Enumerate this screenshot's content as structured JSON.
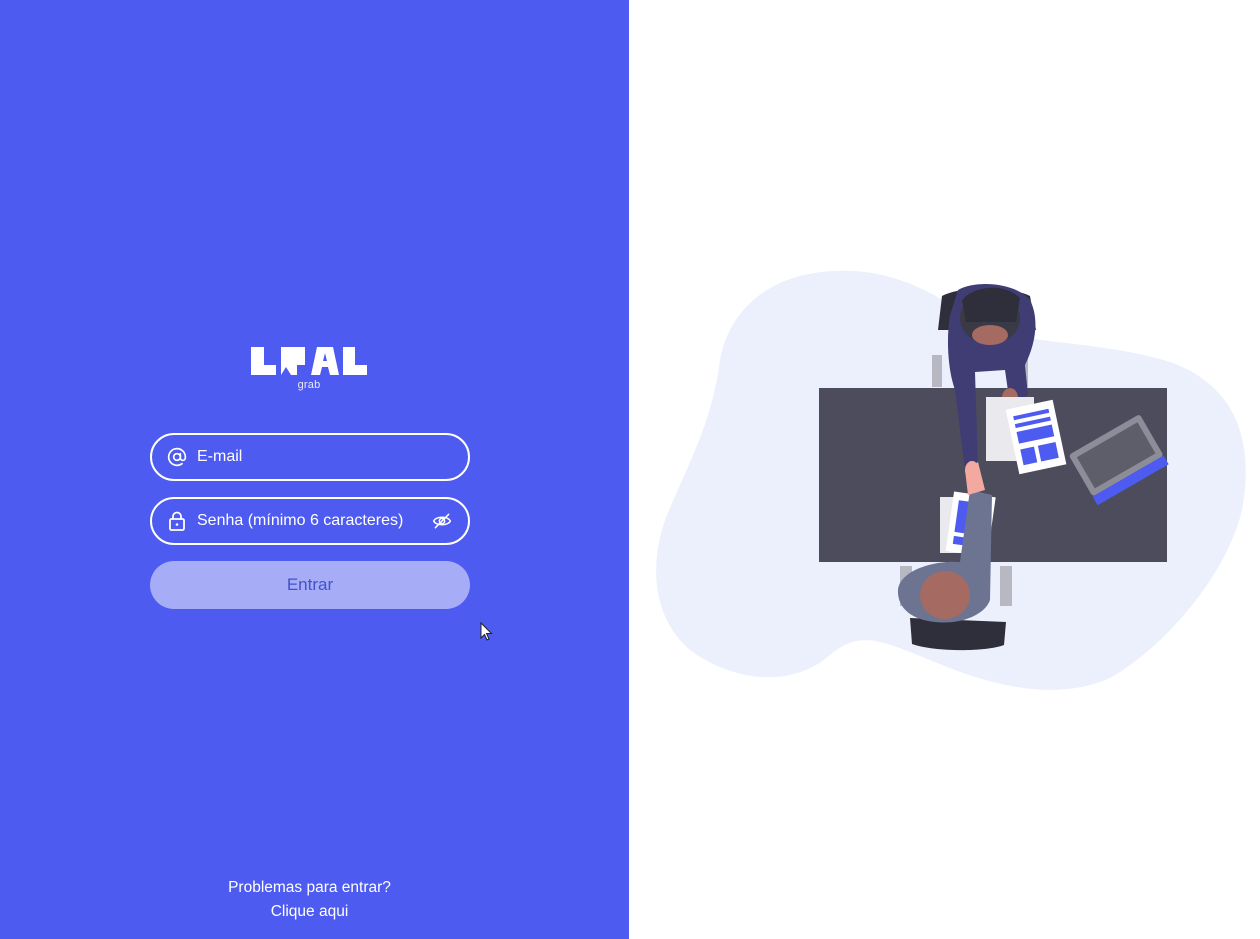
{
  "brand": {
    "logo_name": "grab-logo",
    "subtitle": "grab"
  },
  "form": {
    "email": {
      "placeholder": "E-mail",
      "icon": "at-sign-icon"
    },
    "password": {
      "placeholder": "Senha (mínimo 6 caracteres)",
      "icon": "lock-icon",
      "toggle_icon": "eye-off-icon"
    },
    "submit_label": "Entrar"
  },
  "help": {
    "question": "Problemas para entrar?",
    "link": "Clique aqui"
  },
  "colors": {
    "primary": "#4d5bf0",
    "button_disabled": "#a6adf6",
    "button_text": "#4451c9",
    "illustration_blob": "#eceffc",
    "desk": "#4d4c5c"
  }
}
